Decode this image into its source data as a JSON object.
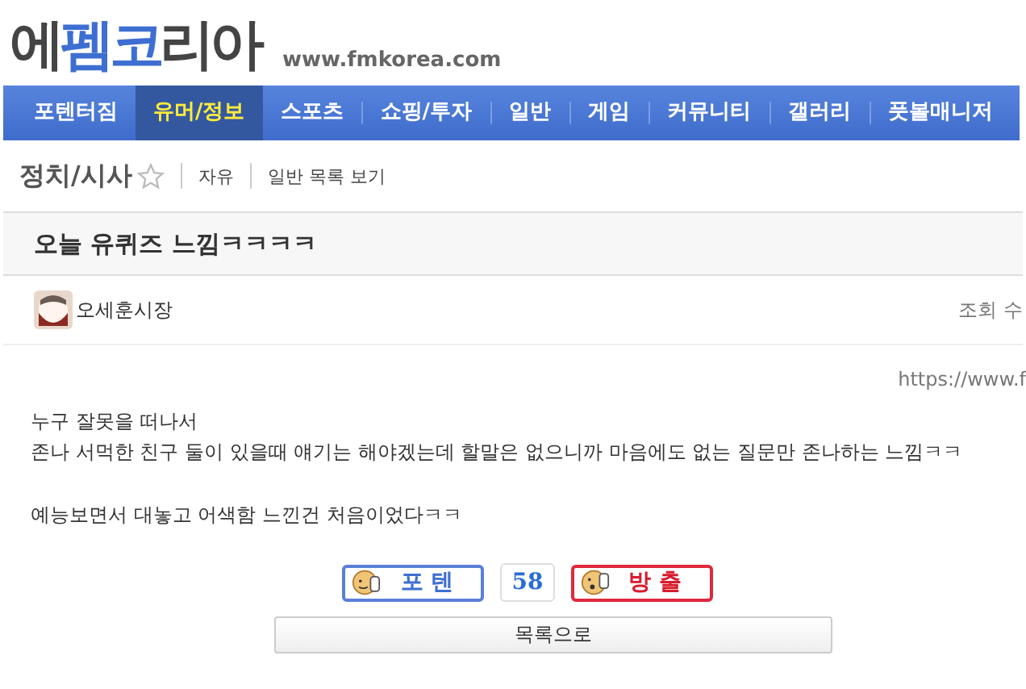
{
  "logo": {
    "parts": [
      {
        "text": "에",
        "accent": false
      },
      {
        "text": "펨코",
        "accent": true
      },
      {
        "text": "리아",
        "accent": false
      }
    ],
    "url": "www.fmkorea.com"
  },
  "nav": [
    {
      "label": "포텐터짐",
      "selected": false
    },
    {
      "label": "유머/정보",
      "selected": true
    },
    {
      "label": "스포츠",
      "selected": false
    },
    {
      "label": "쇼핑/투자",
      "selected": false
    },
    {
      "label": "일반",
      "selected": false
    },
    {
      "label": "게임",
      "selected": false
    },
    {
      "label": "커뮤니티",
      "selected": false
    },
    {
      "label": "갤러리",
      "selected": false
    },
    {
      "label": "풋볼매니저",
      "selected": false
    }
  ],
  "board": {
    "title": "정치/시사",
    "links": [
      "자유",
      "일반 목록 보기"
    ]
  },
  "post": {
    "title": "오늘 유퀴즈 느낌ㅋㅋㅋㅋ",
    "author": "오세훈시장",
    "views_label": "조회 수",
    "url": "https://www.f",
    "paragraphs": [
      [
        "누구 잘못을 떠나서",
        "존나 서먹한 친구 둘이 있을때 얘기는 해야겠는데 할말은 없으니까 마음에도 없는 질문만 존나하는 느낌ㅋㅋ"
      ],
      [
        "예능보면서 대놓고 어색함 느낀건 처음이었다ㅋㅋ"
      ]
    ]
  },
  "votes": {
    "up": "포 텐",
    "count": "58",
    "down": "방 출"
  },
  "list_button": "목록으로"
}
